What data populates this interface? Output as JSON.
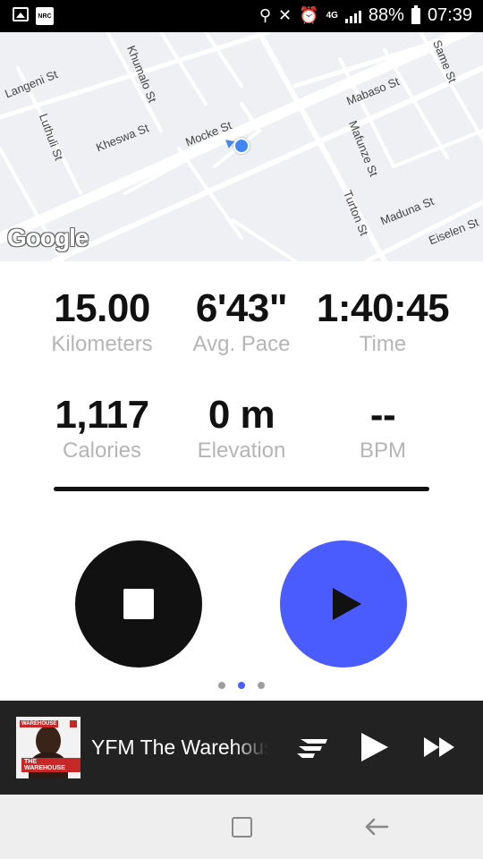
{
  "status_bar": {
    "battery": "88%",
    "time": "07:39",
    "network": "4G",
    "nrc_icon_text": "NRC"
  },
  "map": {
    "streets": [
      {
        "name": "Langeni St"
      },
      {
        "name": "Khumalo St"
      },
      {
        "name": "Luthuli St"
      },
      {
        "name": "Kheswa St"
      },
      {
        "name": "Mocke St"
      },
      {
        "name": "Mabaso St"
      },
      {
        "name": "Same St"
      },
      {
        "name": "Mafunze St"
      },
      {
        "name": "Maduna St"
      },
      {
        "name": "Turton St"
      },
      {
        "name": "Eiselen St"
      }
    ],
    "attribution": "Google"
  },
  "stats": {
    "distance": {
      "value": "15.00",
      "label": "Kilometers"
    },
    "pace": {
      "value": "6'43\"",
      "label": "Avg. Pace"
    },
    "time": {
      "value": "1:40:45",
      "label": "Time"
    },
    "calories": {
      "value": "1,117",
      "label": "Calories"
    },
    "elevation": {
      "value": "0 m",
      "label": "Elevation"
    },
    "bpm": {
      "value": "--",
      "label": "BPM"
    }
  },
  "controls": {
    "stop_icon": "stop-icon",
    "play_icon": "play-icon",
    "pager_count": 3,
    "pager_active": 1
  },
  "media": {
    "title": "YFM The Warehouse",
    "album_tag": "WAREHOUSE",
    "album_title": "THE WAREHOUSE"
  },
  "colors": {
    "accent": "#4b5cff",
    "dark": "#111111",
    "label_gray": "#b5b5b5",
    "media_bg": "#222222"
  }
}
